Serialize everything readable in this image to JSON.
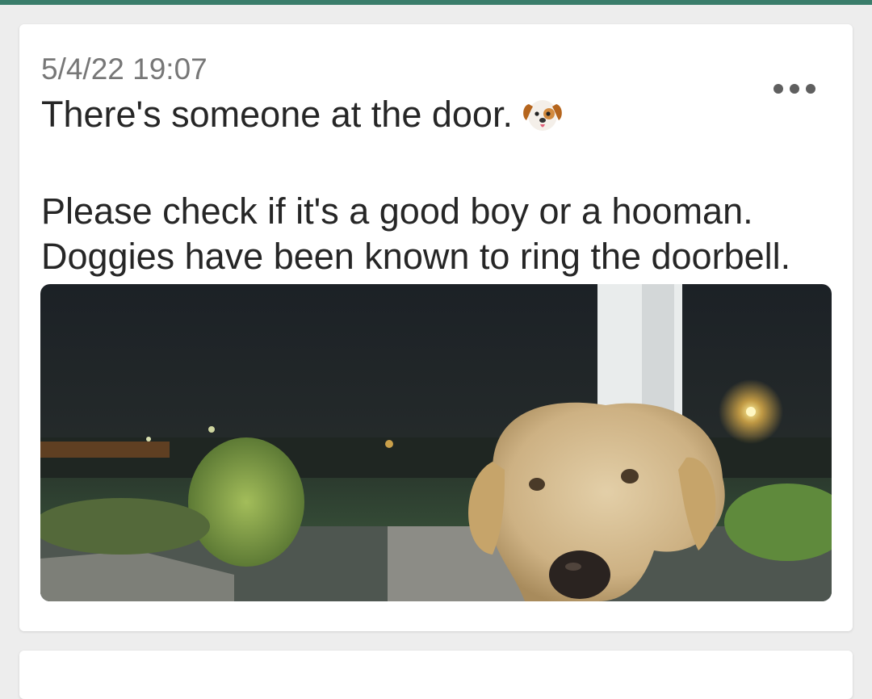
{
  "theme": {
    "accent": "#3a7d6b"
  },
  "post": {
    "timestamp": "5/4/22 19:07",
    "line1": "There's someone at the door.",
    "line1_emoji_icon": "dog-face-icon",
    "line2": "Please check if it's a good boy or a hooman.",
    "line3": "Doggies have been known to ring the doorbell.",
    "menu_icon": "more-horizontal-icon",
    "photo_subject": "doorbell-camera-photo"
  }
}
